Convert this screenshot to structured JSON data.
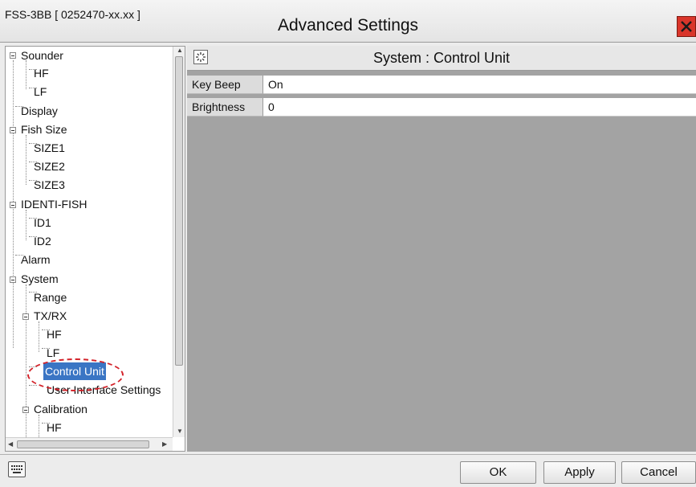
{
  "window": {
    "app_id": "FSS-3BB [ 0252470-xx.xx ]",
    "title": "Advanced Settings",
    "close_icon": "close-icon"
  },
  "tree": {
    "items": [
      {
        "label": "Sounder"
      },
      {
        "label": "HF"
      },
      {
        "label": "LF"
      },
      {
        "label": "Display"
      },
      {
        "label": "Fish Size"
      },
      {
        "label": "SIZE1"
      },
      {
        "label": "SIZE2"
      },
      {
        "label": "SIZE3"
      },
      {
        "label": "IDENTI-FISH"
      },
      {
        "label": "ID1"
      },
      {
        "label": "ID2"
      },
      {
        "label": "Alarm"
      },
      {
        "label": "System"
      },
      {
        "label": "Range"
      },
      {
        "label": "TX/RX"
      },
      {
        "label": "HF"
      },
      {
        "label": "LF"
      },
      {
        "label": "Control Unit"
      },
      {
        "label": "User Interface Settings"
      },
      {
        "label": "Calibration"
      },
      {
        "label": "HF"
      }
    ],
    "selected": "Control Unit"
  },
  "panel": {
    "title": "System : Control Unit",
    "icon": "settings-icon",
    "rows": [
      {
        "key": "Key Beep",
        "value": "On"
      },
      {
        "key": "Brightness",
        "value": "0"
      }
    ]
  },
  "footer": {
    "keyboard_icon": "keyboard-icon",
    "ok": "OK",
    "apply": "Apply",
    "cancel": "Cancel"
  },
  "colors": {
    "selection": "#3a75c4",
    "close_button": "#d9352a",
    "highlight_ring": "#d3232a",
    "panel_background": "#a3a3a3"
  }
}
